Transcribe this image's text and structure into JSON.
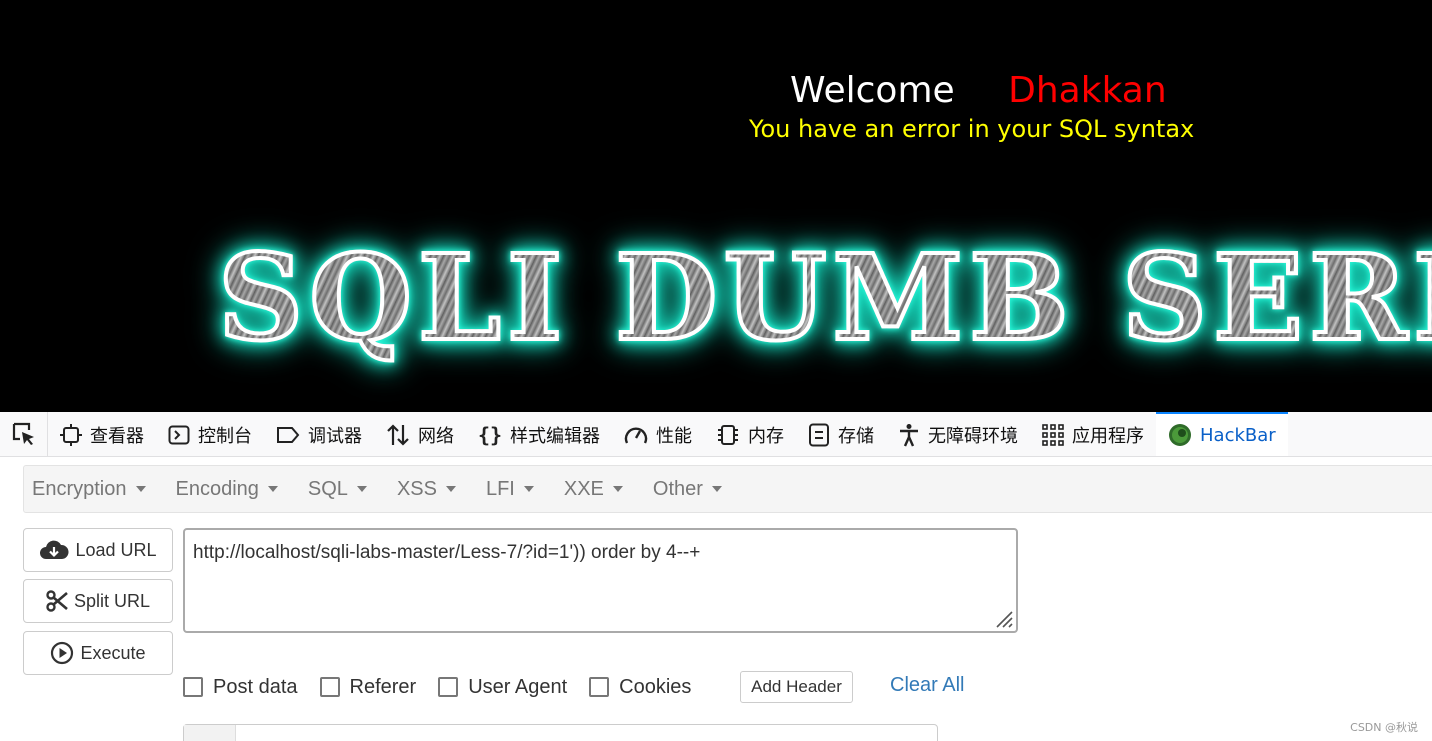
{
  "page": {
    "welcome": "Welcome",
    "user_name": "Dhakkan",
    "error_message": "You have an error in your SQL syntax",
    "banner_text": "SQLI DUMB SERIES"
  },
  "devtools": {
    "tabs": [
      {
        "label": "查看器",
        "icon": "inspector-icon"
      },
      {
        "label": "控制台",
        "icon": "console-icon"
      },
      {
        "label": "调试器",
        "icon": "debugger-icon"
      },
      {
        "label": "网络",
        "icon": "network-icon"
      },
      {
        "label": "样式编辑器",
        "icon": "style-editor-icon"
      },
      {
        "label": "性能",
        "icon": "performance-icon"
      },
      {
        "label": "内存",
        "icon": "memory-icon"
      },
      {
        "label": "存储",
        "icon": "storage-icon"
      },
      {
        "label": "无障碍环境",
        "icon": "accessibility-icon"
      },
      {
        "label": "应用程序",
        "icon": "application-icon"
      },
      {
        "label": "HackBar",
        "icon": "hackbar-icon",
        "active": true
      }
    ],
    "active_color": "#0a84ff"
  },
  "hackbar": {
    "menu": [
      "Encryption",
      "Encoding",
      "SQL",
      "XSS",
      "LFI",
      "XXE",
      "Other"
    ],
    "buttons": {
      "load_url": "Load URL",
      "split_url": "Split URL",
      "execute": "Execute"
    },
    "url_value": "http://localhost/sqli-labs-master/Less-7/?id=1')) order by 4--+",
    "options": [
      "Post data",
      "Referer",
      "User Agent",
      "Cookies"
    ],
    "add_header": "Add Header",
    "clear_all": "Clear All"
  },
  "watermark": "CSDN @秋说"
}
